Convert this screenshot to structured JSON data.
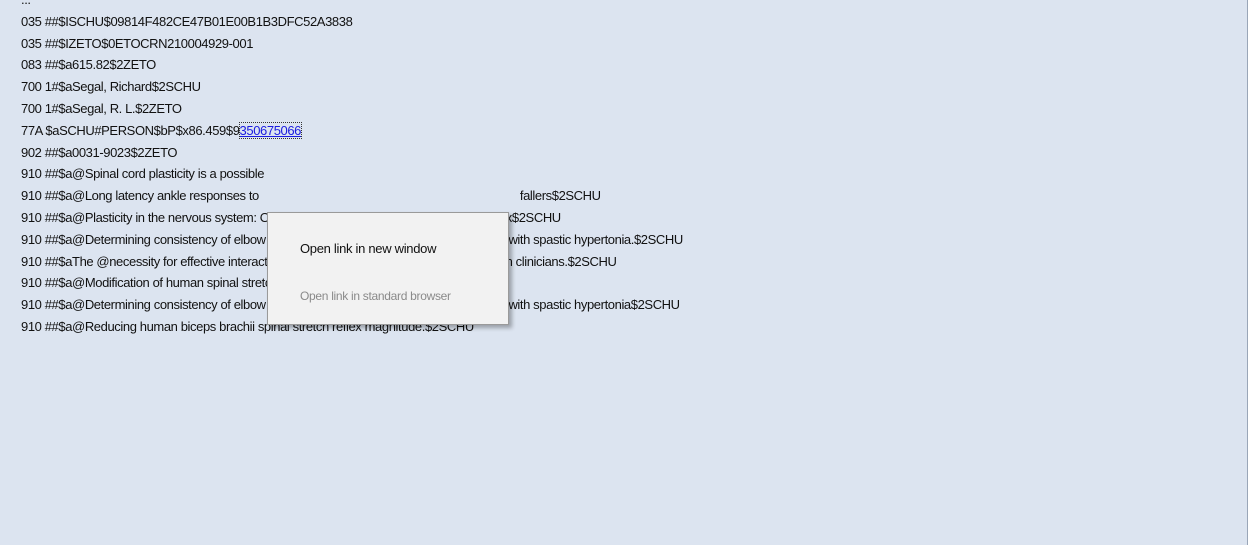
{
  "record_lines": [
    "...",
    "035 ##$ISCHU$09814F482CE47B01E00B1B3DFC52A3838",
    "035 ##$IZETO$0ETOCRN210004929-001",
    "083 ##$a615.82$2ZETO",
    "700 1#$aSegal, Richard$2SCHU",
    "700 1#$aSegal, R. L.$2ZETO",
    "",
    "902 ##$a0031-9023$2ZETO",
    "910 ##$a@Spinal cord plasticity is a possible",
    "910 ##$a@Long latency ankle responses to",
    "910 ##$a@Plasticity in the nervous system: Operant conditioning of the spinal stretch reflex$2SCHU",
    "910 ##$a@Determining consistency of elbow joint threshold angle in elbow flexor muscles with spastic hypertonia.$2SCHU",
    "910 ##$aThe @necessity for effective interaction between basic scientists and rehabilitation clinicians.$2SCHU",
    "910 ##$a@Modification of human spinal stretch reflexes: preliminary studies.$2SCHU",
    "910 ##$a@Determining consistency of elbow joint threhsold angle in elbow flexor muscles with spastic hypertonia$2SCHU",
    "910 ##$a@Reducing human biceps brachii spinal stretch reflex magnitude.$2SCHU"
  ],
  "link_line": {
    "prefix": "77A $aSCHU#PERSON$bP$x86.459$9",
    "link_text": "350675066"
  },
  "hidden_fragment": "fallers$2SCHU",
  "context_menu": {
    "open_new_window": "Open link in new window",
    "open_standard_browser": "Open link in standard browser"
  }
}
